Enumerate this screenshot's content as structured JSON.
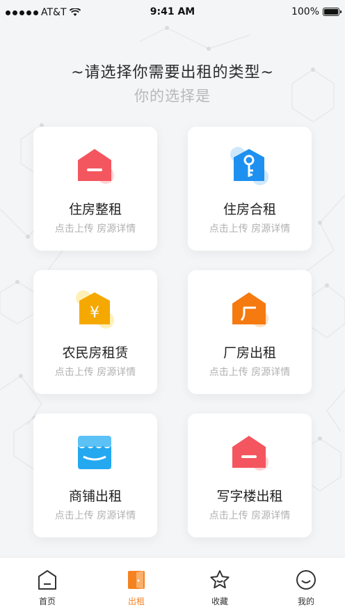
{
  "status_bar": {
    "carrier": "AT&T",
    "time": "9:41 AM",
    "battery": "100%"
  },
  "header": {
    "title": "~请选择你需要出租的类型~",
    "subtitle": "你的选择是"
  },
  "cards": [
    {
      "name": "住房整租",
      "desc": "点击上传 房源详情",
      "icon": "house-icon",
      "color": "#f4565f"
    },
    {
      "name": "住房合租",
      "desc": "点击上传 房源详情",
      "icon": "key-icon",
      "color": "#1e90f0"
    },
    {
      "name": "农民房租赁",
      "desc": "点击上传 房源详情",
      "icon": "yuan-icon",
      "color": "#f5a800"
    },
    {
      "name": "厂房出租",
      "desc": "点击上传 房源详情",
      "icon": "factory-icon",
      "color": "#f57a10"
    },
    {
      "name": "商铺出租",
      "desc": "点击上传 房源详情",
      "icon": "shop-icon",
      "color": "#24a8f0"
    },
    {
      "name": "写字楼出租",
      "desc": "点击上传 房源详情",
      "icon": "house-icon",
      "color": "#f4565f"
    }
  ],
  "tabbar": {
    "active_color": "#f58220",
    "items": [
      {
        "label": "首页",
        "icon": "home-icon"
      },
      {
        "label": "出租",
        "icon": "door-icon"
      },
      {
        "label": "收藏",
        "icon": "star-icon"
      },
      {
        "label": "我的",
        "icon": "smile-icon"
      }
    ]
  }
}
